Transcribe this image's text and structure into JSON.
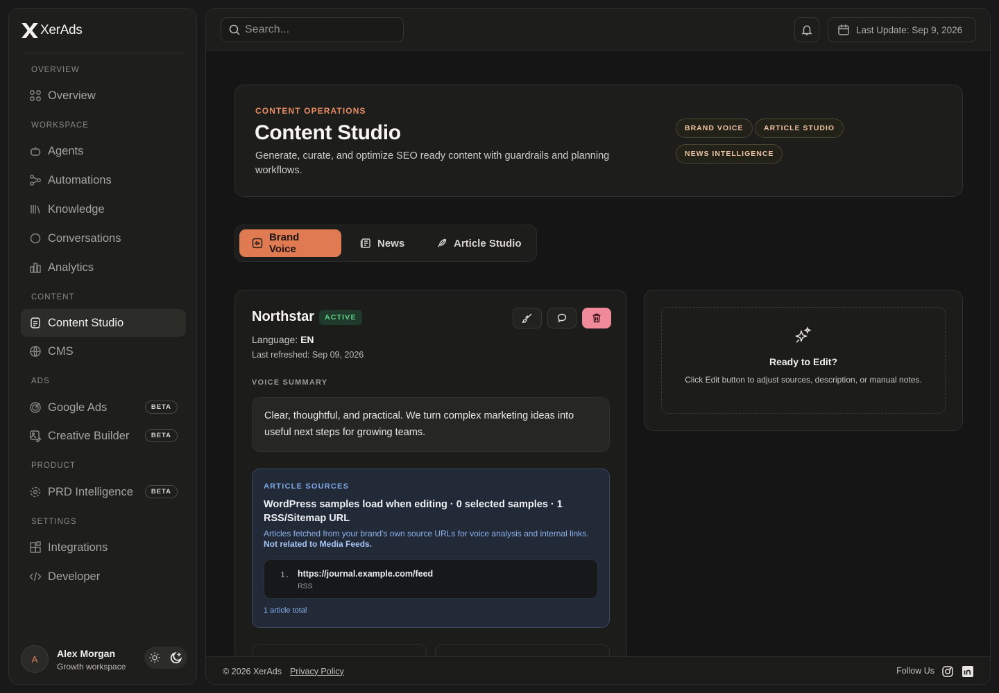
{
  "brand": {
    "name": "XerAds"
  },
  "sidebar": {
    "sections": {
      "overview": "OVERVIEW",
      "workspace": "WORKSPACE",
      "content": "CONTENT",
      "ads": "ADS",
      "product": "PRODUCT",
      "settings": "SETTINGS"
    },
    "items": {
      "overview": {
        "label": "Overview",
        "icon": "grid-icon"
      },
      "agents": {
        "label": "Agents",
        "icon": "bot-icon"
      },
      "automations": {
        "label": "Automations",
        "icon": "workflow-icon"
      },
      "knowledge": {
        "label": "Knowledge",
        "icon": "library-icon"
      },
      "conversations": {
        "label": "Conversations",
        "icon": "chat-icon"
      },
      "analytics": {
        "label": "Analytics",
        "icon": "chart-icon"
      },
      "content_studio": {
        "label": "Content Studio",
        "icon": "document-icon",
        "active": true
      },
      "cms": {
        "label": "CMS",
        "icon": "globe-icon"
      },
      "google_ads": {
        "label": "Google Ads",
        "icon": "target-icon",
        "badge": "BETA"
      },
      "creative_builder": {
        "label": "Creative Builder",
        "icon": "image-edit-icon",
        "badge": "BETA"
      },
      "prd_intelligence": {
        "label": "PRD Intelligence",
        "icon": "cog-icon",
        "badge": "BETA"
      },
      "integrations": {
        "label": "Integrations",
        "icon": "blocks-icon"
      },
      "developer": {
        "label": "Developer",
        "icon": "code-icon"
      }
    }
  },
  "user": {
    "initial": "A",
    "name": "Alex Morgan",
    "workspace": "Growth workspace"
  },
  "topbar": {
    "search_placeholder": "Search...",
    "last_update": "Last Update: Sep 9, 2026"
  },
  "hero": {
    "eyebrow": "CONTENT OPERATIONS",
    "title": "Content Studio",
    "description": "Generate, curate, and optimize SEO ready content with guardrails and planning workflows.",
    "tags": [
      "BRAND VOICE",
      "ARTICLE STUDIO",
      "NEWS INTELLIGENCE"
    ]
  },
  "tabs": [
    {
      "label": "Brand Voice",
      "icon": "voice-icon",
      "active": true
    },
    {
      "label": "News",
      "icon": "newspaper-icon",
      "active": false
    },
    {
      "label": "Article Studio",
      "icon": "feather-icon",
      "active": false
    }
  ],
  "voice": {
    "name": "Northstar",
    "status": "ACTIVE",
    "language_label": "Language:",
    "language": "EN",
    "last_refreshed": "Last refreshed: Sep 09, 2026",
    "summary_label": "VOICE SUMMARY",
    "summary": "Clear, thoughtful, and practical. We turn complex marketing ideas into useful next steps for growing teams.",
    "sources": {
      "label": "ARTICLE SOURCES",
      "title": "WordPress samples load when editing · 0 selected samples · 1 RSS/Sitemap URL",
      "description": "Articles fetched from your brand's own source URLs for voice analysis and internal links.",
      "description_note": "Not related to Media Feeds.",
      "items": [
        {
          "index": "1.",
          "url": "https://journal.example.com/feed",
          "type": "RSS"
        }
      ],
      "total": "1 article total"
    }
  },
  "ready": {
    "title": "Ready to Edit?",
    "description": "Click Edit button to adjust sources, description, or manual notes."
  },
  "footer": {
    "copyright": "© 2026 XerAds",
    "privacy": "Privacy Policy",
    "follow": "Follow Us"
  },
  "colors": {
    "accent": "#e07a52",
    "eyebrow": "#e88d63",
    "success": "#5fd28d",
    "danger": "#f0899a",
    "info": "#7ea7e8"
  }
}
